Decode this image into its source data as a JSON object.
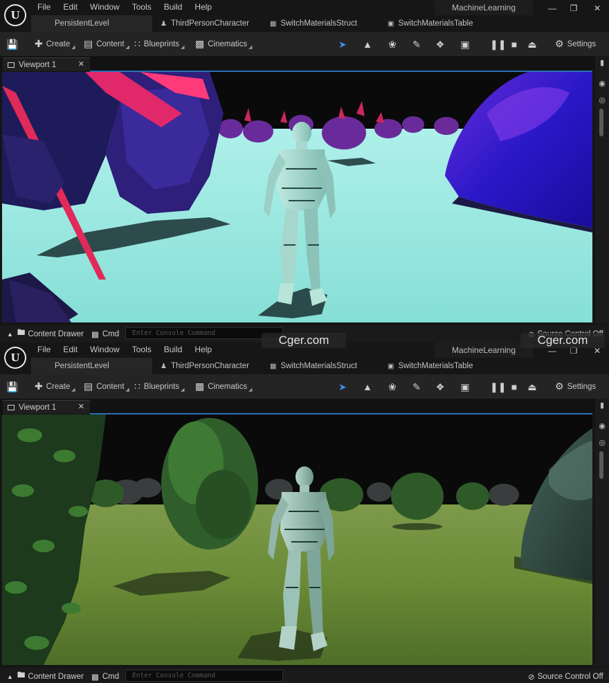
{
  "menu": [
    "File",
    "Edit",
    "Window",
    "Tools",
    "Build",
    "Help"
  ],
  "project": "MachineLearning",
  "tabs": {
    "level": "PersistentLevel",
    "character": "ThirdPersonCharacter",
    "struct": "SwitchMaterialsStruct",
    "table": "SwitchMaterialsTable"
  },
  "toolbar": {
    "create": "Create",
    "content": "Content",
    "blueprints": "Blueprints",
    "cinematics": "Cinematics",
    "settings": "Settings"
  },
  "viewport_tab": "Viewport 1",
  "status": {
    "content_drawer": "Content Drawer",
    "cmd": "Cmd",
    "console_placeholder": "Enter Console Command",
    "source_control": "Source Control Off"
  },
  "watermark": "Cger.com",
  "icons": [
    "unreal-logo",
    "save-icon",
    "create-icon",
    "content-icon",
    "blueprints-icon",
    "cinematics-icon",
    "select-mode-icon",
    "landscape-icon",
    "foliage-icon",
    "paint-icon",
    "fracture-icon",
    "modeling-icon",
    "pause-icon",
    "stop-icon",
    "eject-icon",
    "settings-gear-icon",
    "minimize-icon",
    "maximize-icon",
    "close-icon"
  ],
  "colors": {
    "titlebar": "#161616",
    "toolbar": "#242424",
    "accent_blue": "#2a6fb5",
    "scene1_ground": "#8fe3dc",
    "scene2_ground": "#6d8a3c"
  }
}
